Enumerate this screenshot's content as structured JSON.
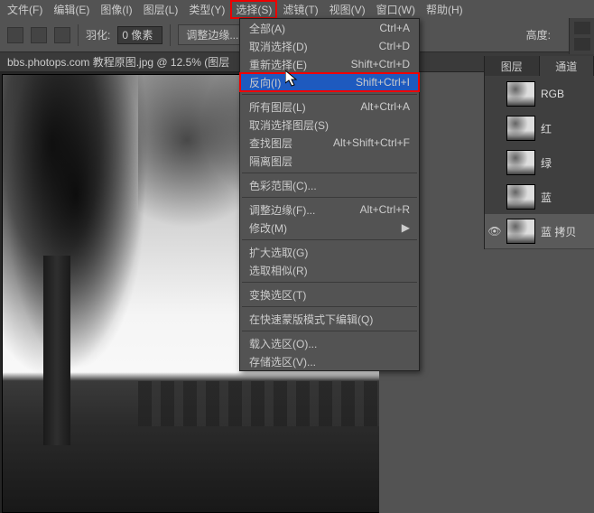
{
  "menubar": {
    "file": "文件(F)",
    "edit": "编辑(E)",
    "image": "图像(I)",
    "layer": "图层(L)",
    "type": "类型(Y)",
    "select": "选择(S)",
    "filter": "滤镜(T)",
    "view": "视图(V)",
    "window": "窗口(W)",
    "help": "帮助(H)"
  },
  "toolbar": {
    "feather_label": "羽化:",
    "feather_value": "0 像素",
    "refine": "调整边缘...",
    "height_label": "高度:"
  },
  "doc_tab": "bbs.photops.com 教程原图.jpg @ 12.5% (图层",
  "dropdown": {
    "all": {
      "l": "全部(A)",
      "s": "Ctrl+A"
    },
    "deselect": {
      "l": "取消选择(D)",
      "s": "Ctrl+D"
    },
    "reselect": {
      "l": "重新选择(E)",
      "s": "Shift+Ctrl+D"
    },
    "inverse": {
      "l": "反向(I)",
      "s": "Shift+Ctrl+I"
    },
    "all_layers": {
      "l": "所有图层(L)",
      "s": "Alt+Ctrl+A"
    },
    "deselect_layers": {
      "l": "取消选择图层(S)",
      "s": ""
    },
    "find_layers": {
      "l": "查找图层",
      "s": "Alt+Shift+Ctrl+F"
    },
    "isolate": {
      "l": "隔离图层",
      "s": ""
    },
    "color_range": {
      "l": "色彩范围(C)...",
      "s": ""
    },
    "refine_edge": {
      "l": "调整边缘(F)...",
      "s": "Alt+Ctrl+R"
    },
    "modify": {
      "l": "修改(M)",
      "s": ""
    },
    "grow": {
      "l": "扩大选取(G)",
      "s": ""
    },
    "similar": {
      "l": "选取相似(R)",
      "s": ""
    },
    "transform": {
      "l": "变换选区(T)",
      "s": ""
    },
    "quickmask": {
      "l": "在快速蒙版模式下编辑(Q)",
      "s": ""
    },
    "load": {
      "l": "载入选区(O)...",
      "s": ""
    },
    "save": {
      "l": "存储选区(V)...",
      "s": ""
    }
  },
  "panel": {
    "tab_layers": "图层",
    "tab_channels": "通道",
    "rgb": "RGB",
    "red": "红",
    "green": "绿",
    "blue": "蓝",
    "blue_copy": "蓝 拷贝"
  }
}
